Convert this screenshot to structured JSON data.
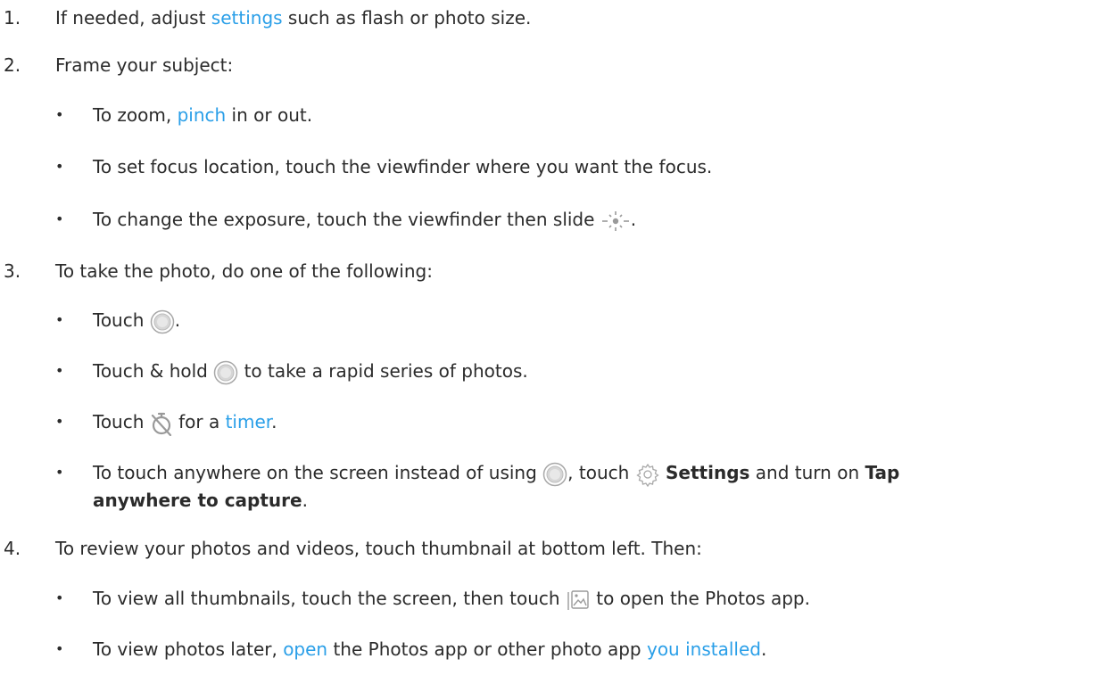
{
  "steps": [
    {
      "number": "1.",
      "pre": "If needed, adjust ",
      "link": "settings",
      "post": " such as flash or photo size."
    },
    {
      "number": "2.",
      "text": "Frame your subject:",
      "bullets": [
        {
          "pre": "To zoom, ",
          "link": "pinch",
          "post": " in or out."
        },
        {
          "text": "To set focus location, touch the viewfinder where you want the focus."
        },
        {
          "pre": "To change the exposure, touch the viewfinder then slide ",
          "icon": "exposure-slider-icon",
          "post": "."
        }
      ]
    },
    {
      "number": "3.",
      "text": "To take the photo, do one of the following:",
      "bullets": [
        {
          "pre": "Touch ",
          "icon": "shutter-button-icon",
          "post": "."
        },
        {
          "pre": "Touch & hold ",
          "icon": "shutter-button-icon",
          "post": " to take a rapid series of photos."
        },
        {
          "pre": "Touch ",
          "icon": "timer-off-icon",
          "mid": " for a ",
          "link": "timer",
          "post": "."
        },
        {
          "pre": "To touch anywhere on the screen instead of using ",
          "icon": "shutter-button-icon",
          "mid": ", touch ",
          "icon2": "gear-icon",
          "bold1": "Settings",
          "mid2": " and turn on ",
          "bold2a": "Tap",
          "bold2b": "anywhere to capture",
          "post": "."
        }
      ]
    },
    {
      "number": "4.",
      "text": "To review your photos and videos, touch thumbnail at bottom left. Then:",
      "bullets": [
        {
          "pre": "To view all thumbnails, touch the screen, then touch ",
          "icon": "photos-gallery-icon",
          "post": " to open the Photos app."
        },
        {
          "pre": "To view photos later, ",
          "link": "open",
          "mid": " the Photos app or other photo app ",
          "link2": "you installed",
          "post": "."
        }
      ]
    }
  ],
  "bullet_glyph": "•",
  "colors": {
    "text": "#2b2b2b",
    "link": "#2a9fe8",
    "icon": "#9a9a9a"
  }
}
